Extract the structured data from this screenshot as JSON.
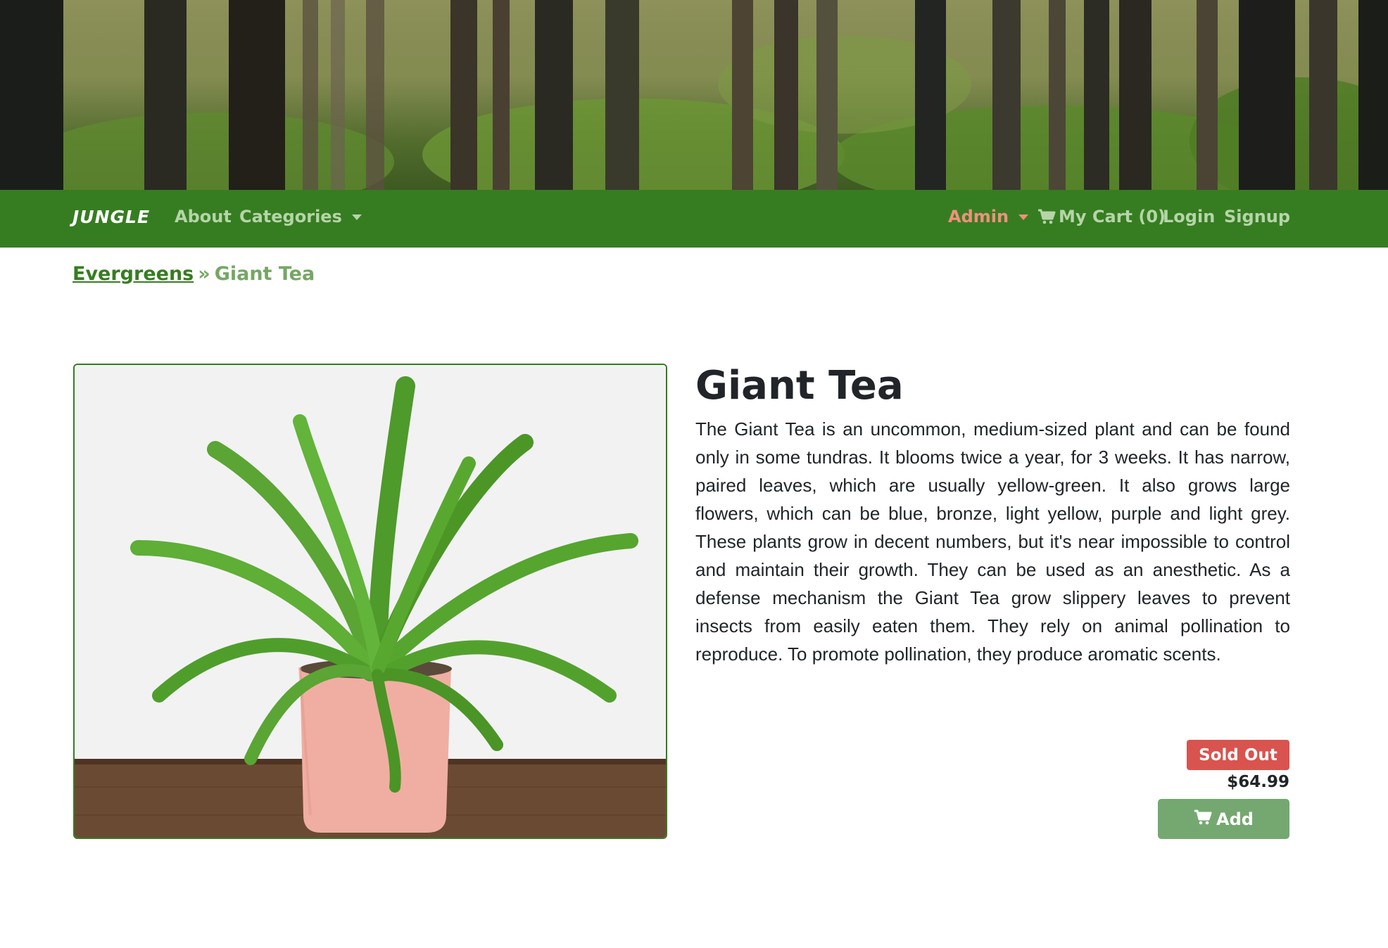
{
  "navbar": {
    "brand": "JUNGLE",
    "about": "About",
    "categories": "Categories",
    "admin": "Admin",
    "cart": "My Cart (0)",
    "login": "Login",
    "signup": "Signup"
  },
  "breadcrumb": {
    "category": "Evergreens",
    "separator": "»",
    "current": "Giant Tea"
  },
  "product": {
    "name": "Giant Tea",
    "description": "The Giant Tea is an uncommon, medium-sized plant and can be found only in some tundras. It blooms twice a year, for 3 weeks. It has narrow, paired leaves, which are usually yellow-green. It also grows large flowers, which can be blue, bronze, light yellow, purple and light grey. These plants grow in decent numbers, but it's near impossible to control and maintain their growth. They can be used as an anesthetic. As a defense mechanism the Giant Tea grow slippery leaves to prevent insects from easily eaten them. They rely on animal pollination to reproduce. To promote pollination, they produce aromatic scents.",
    "status_badge": "Sold Out",
    "price": "$64.99",
    "add_label": "Add"
  },
  "icons": {
    "cart": "shopping-cart-icon",
    "caret": "caret-down-icon"
  },
  "colors": {
    "navbar": "#367d21",
    "nav_link": "#b5d5a8",
    "admin": "#f0907d",
    "sold_out": "#d9534f",
    "add_button": "#75a870"
  }
}
